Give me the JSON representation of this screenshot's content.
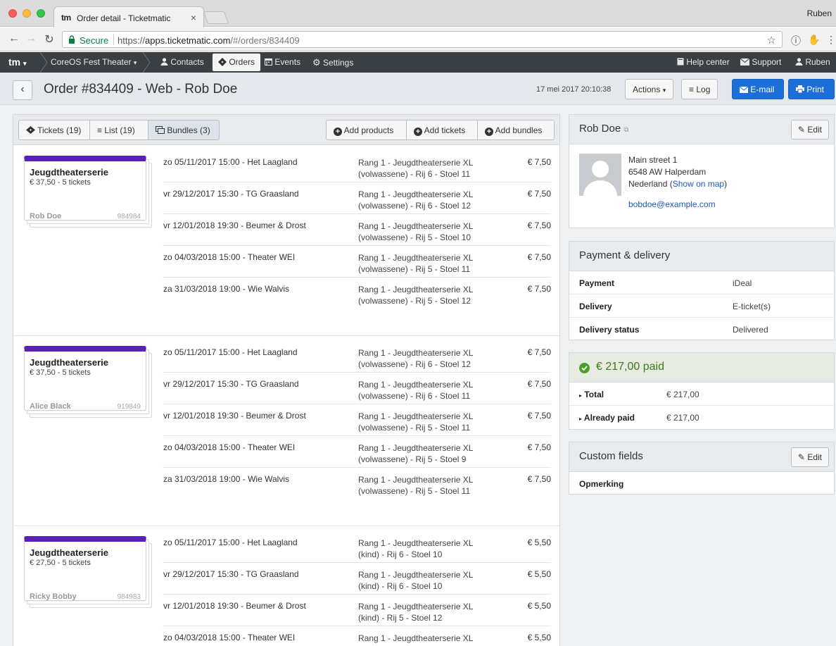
{
  "browser": {
    "tab_title": "Order detail - Ticketmatic",
    "tab_favicon_text": "tm",
    "profile_name": "Ruben",
    "secure_label": "Secure",
    "url_scheme": "https://",
    "url_host": "apps.ticketmatic.com",
    "url_path": "/#/orders/834409"
  },
  "appnav": {
    "logo": "tm",
    "account": "CoreOS Fest Theater",
    "items": [
      {
        "label": "Contacts",
        "icon": "user-icon"
      },
      {
        "label": "Orders",
        "icon": "ticket-icon",
        "active": true
      },
      {
        "label": "Events",
        "icon": "calendar-icon"
      },
      {
        "label": "Settings",
        "icon": "gear-icon"
      }
    ],
    "right": [
      {
        "label": "Help center",
        "icon": "book-icon"
      },
      {
        "label": "Support",
        "icon": "envelope-icon"
      },
      {
        "label": "Ruben",
        "icon": "user-icon"
      }
    ]
  },
  "header": {
    "title": "Order #834409 - Web - Rob Doe",
    "date": "17 mei 2017 20:10:38",
    "actions_label": "Actions",
    "log_label": "Log",
    "email_label": "E-mail",
    "print_label": "Print"
  },
  "toolbar": {
    "tabs": [
      {
        "label": "Tickets (19)",
        "icon": "ticket-icon"
      },
      {
        "label": "List (19)",
        "icon": "list-icon"
      },
      {
        "label": "Bundles (3)",
        "icon": "bundles-icon",
        "active": true
      }
    ],
    "add_products": "Add products",
    "add_tickets": "Add tickets",
    "add_bundles": "Add bundles"
  },
  "bundles": [
    {
      "title": "Jeugdtheaterserie",
      "subtitle": "€ 37,50 - 5 tickets",
      "holder": "Rob Doe",
      "number": "984984",
      "tickets": [
        {
          "event": "zo 05/11/2017 15:00 - Het Laagland",
          "seat1": "Rang 1 - Jeugdtheaterserie XL",
          "seat2": "(volwassene) - Rij 6 - Stoel 11",
          "price": "€ 7,50"
        },
        {
          "event": "vr 29/12/2017 15:30 - TG Graasland",
          "seat1": "Rang 1 - Jeugdtheaterserie XL",
          "seat2": "(volwassene) - Rij 6 - Stoel 12",
          "price": "€ 7,50"
        },
        {
          "event": "vr 12/01/2018 19:30 - Beumer & Drost",
          "seat1": "Rang 1 - Jeugdtheaterserie XL",
          "seat2": "(volwassene) - Rij 5 - Stoel 10",
          "price": "€ 7,50"
        },
        {
          "event": "zo 04/03/2018 15:00 - Theater WEI",
          "seat1": "Rang 1 - Jeugdtheaterserie XL",
          "seat2": "(volwassene) - Rij 5 - Stoel 11",
          "price": "€ 7,50"
        },
        {
          "event": "za 31/03/2018 19:00 - Wie Walvis",
          "seat1": "Rang 1 - Jeugdtheaterserie XL",
          "seat2": "(volwassene) - Rij 5 - Stoel 12",
          "price": "€ 7,50"
        }
      ]
    },
    {
      "title": "Jeugdtheaterserie",
      "subtitle": "€ 37,50 - 5 tickets",
      "holder": "Alice Black",
      "number": "919849",
      "tickets": [
        {
          "event": "zo 05/11/2017 15:00 - Het Laagland",
          "seat1": "Rang 1 - Jeugdtheaterserie XL",
          "seat2": "(volwassene) - Rij 6 - Stoel 12",
          "price": "€ 7,50"
        },
        {
          "event": "vr 29/12/2017 15:30 - TG Graasland",
          "seat1": "Rang 1 - Jeugdtheaterserie XL",
          "seat2": "(volwassene) - Rij 6 - Stoel 11",
          "price": "€ 7,50"
        },
        {
          "event": "vr 12/01/2018 19:30 - Beumer & Drost",
          "seat1": "Rang 1 - Jeugdtheaterserie XL",
          "seat2": "(volwassene) - Rij 5 - Stoel 11",
          "price": "€ 7,50"
        },
        {
          "event": "zo 04/03/2018 15:00 - Theater WEI",
          "seat1": "Rang 1 - Jeugdtheaterserie XL",
          "seat2": "(volwassene) - Rij 5 - Stoel 9",
          "price": "€ 7,50"
        },
        {
          "event": "za 31/03/2018 19:00 - Wie Walvis",
          "seat1": "Rang 1 - Jeugdtheaterserie XL",
          "seat2": "(volwassene) - Rij 5 - Stoel 11",
          "price": "€ 7,50"
        }
      ]
    },
    {
      "title": "Jeugdtheaterserie",
      "subtitle": "€ 27,50 - 5 tickets",
      "holder": "Ricky Bobby",
      "number": "984983",
      "tickets": [
        {
          "event": "zo 05/11/2017 15:00 - Het Laagland",
          "seat1": "Rang 1 - Jeugdtheaterserie XL",
          "seat2": "(kind) - Rij 6 - Stoel 10",
          "price": "€ 5,50"
        },
        {
          "event": "vr 29/12/2017 15:30 - TG Graasland",
          "seat1": "Rang 1 - Jeugdtheaterserie XL",
          "seat2": "(kind) - Rij 6 - Stoel 10",
          "price": "€ 5,50"
        },
        {
          "event": "vr 12/01/2018 19:30 - Beumer & Drost",
          "seat1": "Rang 1 - Jeugdtheaterserie XL",
          "seat2": "(kind) - Rij 5 - Stoel 12",
          "price": "€ 5,50"
        },
        {
          "event": "zo 04/03/2018 15:00 - Theater WEI",
          "seat1": "Rang 1 - Jeugdtheaterserie XL",
          "seat2": "",
          "price": "€ 5,50"
        }
      ]
    }
  ],
  "contact": {
    "name": "Rob Doe",
    "edit_label": "Edit",
    "street": "Main street 1",
    "city": "6548 AW Halperdam",
    "country": "Nederland",
    "show_map": "Show on map",
    "email": "bobdoe@example.com"
  },
  "payment_delivery": {
    "title": "Payment & delivery",
    "rows": [
      {
        "key": "Payment",
        "value": "iDeal"
      },
      {
        "key": "Delivery",
        "value": "E-ticket(s)"
      },
      {
        "key": "Delivery status",
        "value": "Delivered"
      }
    ]
  },
  "paid": {
    "title": "€ 217,00 paid",
    "rows": [
      {
        "key": "Total",
        "value": "€ 217,00"
      },
      {
        "key": "Already paid",
        "value": "€ 217,00"
      }
    ],
    "accent": "#4a9f25"
  },
  "custom_fields": {
    "title": "Custom fields",
    "edit_label": "Edit",
    "rows": [
      {
        "key": "Opmerking",
        "value": ""
      }
    ]
  },
  "colors": {
    "primary_button": "#1d6fd8",
    "bundle_accent": "#5b21b6",
    "nav_bg": "#3a3f44"
  }
}
